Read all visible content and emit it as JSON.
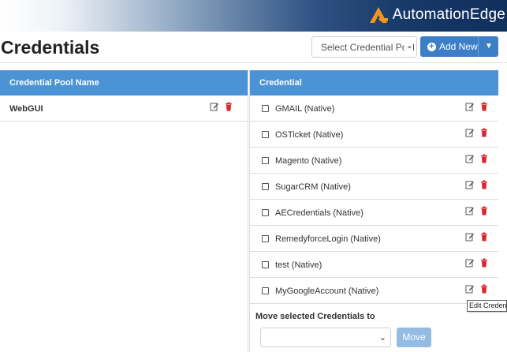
{
  "brand": {
    "name": "AutomationEdge",
    "accent": "#f7941d"
  },
  "header": {
    "title": "Credentials",
    "pool_select": {
      "value": "Select Credential Pool"
    },
    "add_new_label": "Add New"
  },
  "left": {
    "header": "Credential Pool Name",
    "pools": [
      {
        "name": "WebGUI"
      }
    ]
  },
  "right": {
    "header": "Credential",
    "credentials": [
      {
        "label": "GMAIL (Native)"
      },
      {
        "label": "OSTicket (Native)"
      },
      {
        "label": "Magento (Native)"
      },
      {
        "label": "SugarCRM (Native)"
      },
      {
        "label": "AECredentials (Native)"
      },
      {
        "label": "RemedyforceLogin (Native)"
      },
      {
        "label": "test (Native)"
      },
      {
        "label": "MyGoogleAccount (Native)"
      }
    ],
    "move_label": "Move selected Credentials to",
    "move_select_value": "",
    "move_button": "Move"
  },
  "tooltip": "Edit Credential",
  "colors": {
    "header_blue": "#4c93d5",
    "button_blue": "#3c7fc6",
    "delete_red": "#d9262f"
  }
}
